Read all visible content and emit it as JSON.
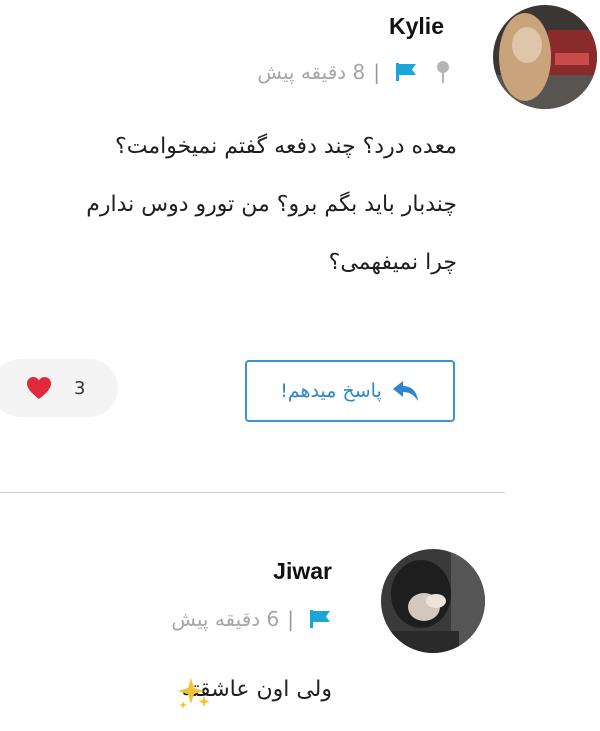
{
  "comments": [
    {
      "author": "Kylie",
      "time_ago": "8 دقیقه پیش",
      "separator": "|",
      "text_lines": [
        "معده درد؟ چند دفعه گفتم نمیخوامت؟",
        "چندبار باید بگم برو؟ من تورو دوس ندارم",
        "چرا نمیفهمی؟"
      ],
      "likes": "3",
      "reply_label": "پاسخ میدهم!"
    },
    {
      "author": "Jiwar",
      "time_ago": "6 دقیقه پیش",
      "separator": "|",
      "text": "ولی اون عاشقته"
    }
  ],
  "icons": {
    "pin": "pin-icon",
    "flag": "flag-icon",
    "heart": "heart-icon",
    "reply": "reply-arrow-icon",
    "sparkle": "sparkle-icon"
  },
  "colors": {
    "accent": "#2f86cc",
    "flag": "#1ba6d9",
    "heart": "#e2283b",
    "meta_text": "#a6a6a6",
    "pill_bg": "#f4f4f4"
  }
}
